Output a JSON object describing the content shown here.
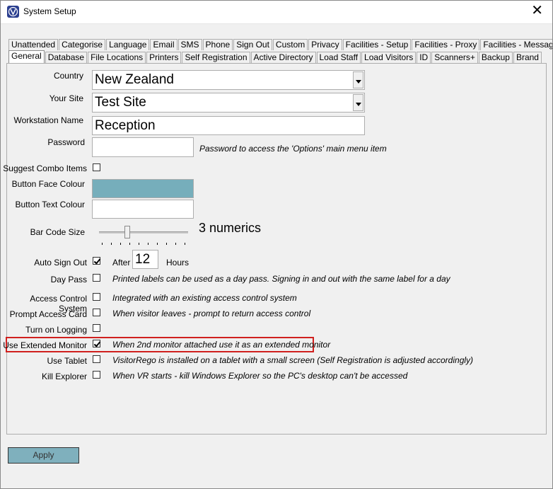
{
  "window": {
    "title": "System Setup",
    "close_glyph": "✕"
  },
  "tabs": {
    "row1": [
      "Unattended",
      "Categorise",
      "Language",
      "Email",
      "SMS",
      "Phone",
      "Sign Out",
      "Custom",
      "Privacy",
      "Facilities - Setup",
      "Facilities - Proxy",
      "Facilities - Messages"
    ],
    "row2": [
      "General",
      "Database",
      "File Locations",
      "Printers",
      "Self Registration",
      "Active Directory",
      "Load Staff",
      "Load Visitors",
      "ID",
      "Scanners+",
      "Backup",
      "Brand"
    ],
    "selected": "General"
  },
  "general": {
    "country_label": "Country",
    "country_value": "New Zealand",
    "site_label": "Your Site",
    "site_value": "Test Site",
    "workstation_label": "Workstation Name",
    "workstation_value": "Reception",
    "password_label": "Password",
    "password_value": "",
    "password_note": "Password to access the 'Options' main menu item",
    "suggest_label": "Suggest Combo Items",
    "suggest_checked": false,
    "face_colour_label": "Button Face Colour",
    "face_colour": "#76aebb",
    "text_colour_label": "Button Text Colour",
    "text_colour": "#ffffff",
    "barcode_label": "Bar Code Size",
    "barcode_value_text": "3 numerics",
    "autosignout_label": "Auto Sign Out",
    "autosignout_checked": true,
    "after_label": "After",
    "after_value": "12",
    "hours_label": "Hours",
    "daypass_label": "Day Pass",
    "daypass_note": "Printed labels can be used as a day pass. Signing in and out with the same label for a day",
    "access_label": "Access Control System",
    "access_note": "Integrated with an existing access control system",
    "prompt_label": "Prompt Access Card",
    "prompt_note": "When visitor leaves - prompt to return access control",
    "logging_label": "Turn on Logging",
    "extmon_label": "Use Extended Monitor",
    "extmon_checked": true,
    "extmon_note": "When 2nd monitor attached use it as an extended monitor",
    "tablet_label": "Use Tablet",
    "tablet_note": "VisitorRego is installed on a tablet with a small screen (Self Registration is adjusted accordingly)",
    "kill_label": "Kill Explorer",
    "kill_note": "When VR starts - kill Windows Explorer so the PC's desktop can't be accessed"
  },
  "footer": {
    "apply_label": "Apply"
  },
  "colors": {
    "highlight": "#d0201e",
    "apply_bg": "#7fb0bd"
  }
}
